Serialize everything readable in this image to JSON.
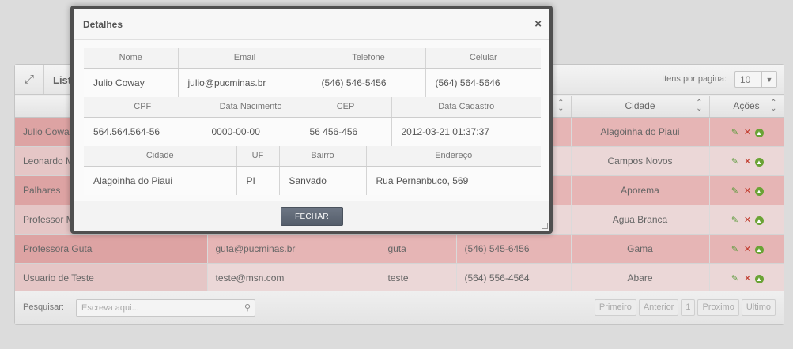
{
  "panel": {
    "title": "List",
    "items_per_page_label": "Itens por pagina:",
    "items_per_page_value": "10",
    "columns": [
      "",
      "",
      "",
      "",
      "Cidade",
      "Ações"
    ],
    "rows": [
      {
        "nome": "Julio Coway",
        "email": "",
        "usuario": "",
        "telefone": "",
        "cidade": "Alagoinha do Piaui"
      },
      {
        "nome": "Leonardo M",
        "email": "",
        "usuario": "",
        "telefone": "",
        "cidade": "Campos Novos"
      },
      {
        "nome": "Palhares",
        "email": "",
        "usuario": "",
        "telefone": "",
        "cidade": "Aporema"
      },
      {
        "nome": "Professor M",
        "email": "",
        "usuario": "",
        "telefone": "",
        "cidade": "Agua Branca"
      },
      {
        "nome": "Professora Guta",
        "email": "guta@pucminas.br",
        "usuario": "guta",
        "telefone": "(546) 545-6456",
        "cidade": "Gama"
      },
      {
        "nome": "Usuario de Teste",
        "email": "teste@msn.com",
        "usuario": "teste",
        "telefone": "(564) 556-4564",
        "cidade": "Abare"
      }
    ],
    "search_label": "Pesquisar:",
    "search_placeholder": "Escreva aqui...",
    "pager": [
      "Primeiro",
      "Anterior",
      "1",
      "Proximo",
      "Ultimo"
    ]
  },
  "modal": {
    "title": "Detalhes",
    "close_symbol": "×",
    "section1": {
      "headers": [
        "Nome",
        "Email",
        "Telefone",
        "Celular"
      ],
      "values": [
        "Julio Coway",
        "julio@pucminas.br",
        "(546) 546-5456",
        "(564) 564-5646"
      ]
    },
    "section2": {
      "headers": [
        "CPF",
        "Data Nacimento",
        "CEP",
        "Data Cadastro"
      ],
      "values": [
        "564.564.564-56",
        "0000-00-00",
        "56 456-456",
        "2012-03-21 01:37:37"
      ]
    },
    "section3": {
      "headers": [
        "Cidade",
        "UF",
        "Bairro",
        "Endereço"
      ],
      "values": [
        "Alagoinha do Piaui",
        "PI",
        "Sanvado",
        "Rua Pernanbuco, 569"
      ]
    },
    "close_button": "FECHAR"
  },
  "icons": {
    "expand": "expand-icon",
    "close": "close-icon",
    "search": "search-icon",
    "edit": "edit-icon",
    "delete": "delete-icon",
    "promote": "arrow-up-icon"
  },
  "colors": {
    "row_odd": "#e6b5b5",
    "row_even": "#ebd7d7",
    "modal_border": "#4f4f4f",
    "button": "#5f6874"
  }
}
